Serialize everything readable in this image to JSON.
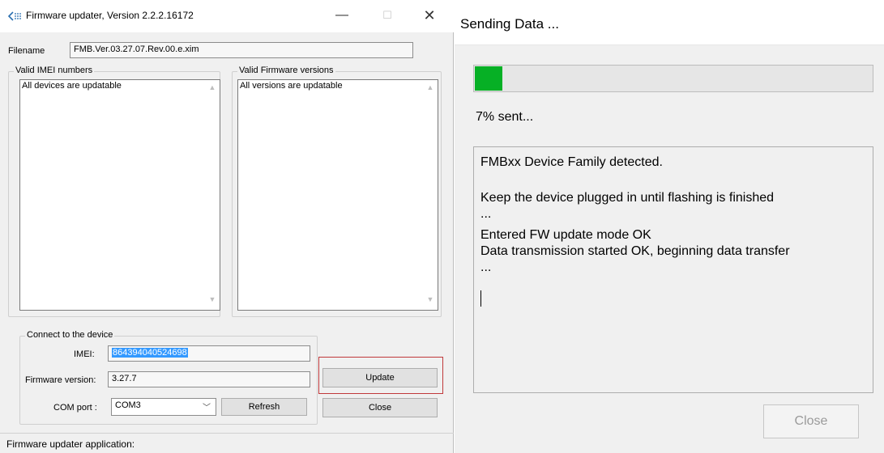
{
  "updater": {
    "title": "Firmware updater, Version 2.2.2.16172",
    "window_buttons": {
      "minimize": "—",
      "maximize": "☐",
      "close": "✕"
    },
    "filename": {
      "label": "Filename",
      "value": "FMB.Ver.03.27.07.Rev.00.e.xim"
    },
    "imei_list": {
      "title": "Valid IMEI numbers",
      "items": [
        "All devices are updatable"
      ]
    },
    "fw_list": {
      "title": "Valid Firmware versions",
      "items": [
        "All versions are updatable"
      ]
    },
    "connect": {
      "title": "Connect to the device",
      "imei_label": "IMEI:",
      "imei_value": "864394040524698",
      "fw_label": "Firmware version:",
      "fw_value": "3.27.7",
      "com_label": "COM port :",
      "com_value": "COM3"
    },
    "buttons": {
      "update": "Update",
      "refresh": "Refresh",
      "close": "Close"
    },
    "status": "Firmware updater application:",
    "icons": {
      "app": "teltonika-icon",
      "highlight_color": "#c0393b"
    }
  },
  "sending": {
    "title": "Sending Data ...",
    "progress_percent": 7,
    "progress_color": "#06b025",
    "progress_text": "7% sent...",
    "log": [
      "FMBxx Device Family detected.",
      "Keep the device plugged in until flashing is finished",
      "...",
      "Entered FW update mode OK",
      "Data transmission started OK, beginning data transfer",
      "..."
    ],
    "close_label": "Close"
  }
}
